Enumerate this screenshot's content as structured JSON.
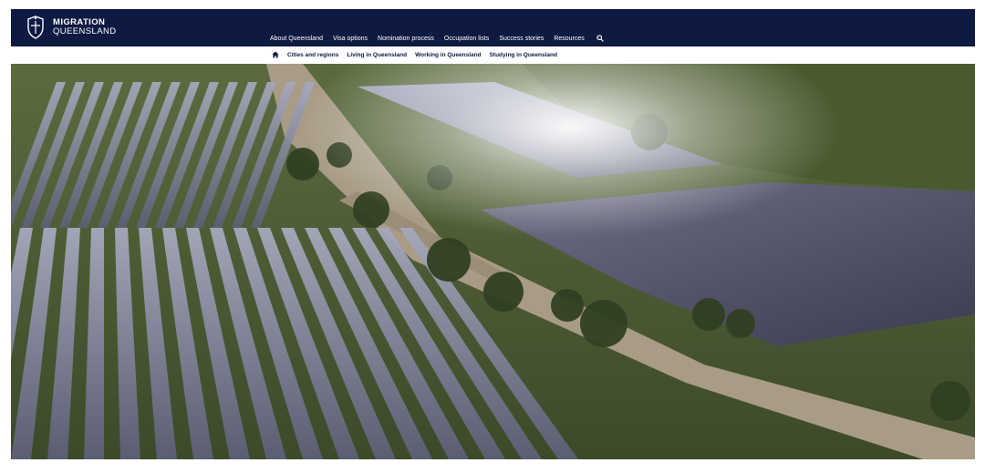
{
  "brand": {
    "line1": "MIGRATION",
    "line2": "QUEENSLAND",
    "crest_icon": "queensland-crest-icon"
  },
  "main_nav": [
    {
      "label": "About Queensland"
    },
    {
      "label": "Visa options"
    },
    {
      "label": "Nomination process"
    },
    {
      "label": "Occupation lists"
    },
    {
      "label": "Success stories"
    },
    {
      "label": "Resources"
    }
  ],
  "sub_nav": [
    {
      "label": "Cities and regions"
    },
    {
      "label": "Living in Queensland"
    },
    {
      "label": "Working in Queensland"
    },
    {
      "label": "Studying in Queensland"
    }
  ],
  "icons": {
    "search": "search-icon",
    "home": "home-icon"
  },
  "colors": {
    "header_bg": "#0e1a42",
    "header_text": "#ffffff",
    "subnav_text": "#0e1a42",
    "page_bg": "#ffffff"
  }
}
